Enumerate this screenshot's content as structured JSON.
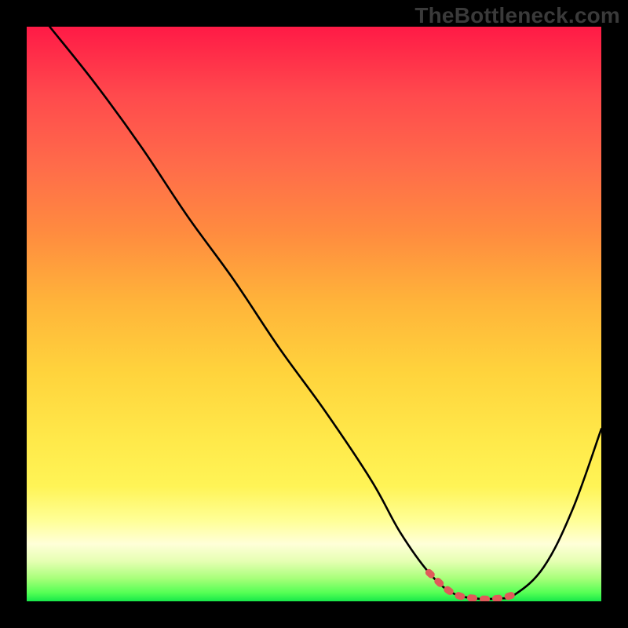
{
  "watermark": "TheBottleneck.com",
  "chart_data": {
    "type": "line",
    "title": "",
    "xlabel": "",
    "ylabel": "",
    "xlim": [
      0,
      100
    ],
    "ylim": [
      0,
      100
    ],
    "series": [
      {
        "name": "curve",
        "color": "#000000",
        "x": [
          4,
          12,
          20,
          28,
          36,
          44,
          52,
          60,
          65,
          70,
          74,
          78,
          82,
          85,
          90,
          95,
          100
        ],
        "y": [
          100,
          90,
          79,
          67,
          56,
          44,
          33,
          21,
          12,
          5,
          1.5,
          0.5,
          0.5,
          1.2,
          6,
          16,
          30
        ]
      },
      {
        "name": "flat-region-highlight",
        "color": "#e05a5a",
        "x": [
          70,
          74,
          78,
          82,
          85
        ],
        "y": [
          5,
          1.5,
          0.5,
          0.5,
          1.2
        ]
      }
    ],
    "annotations": []
  }
}
